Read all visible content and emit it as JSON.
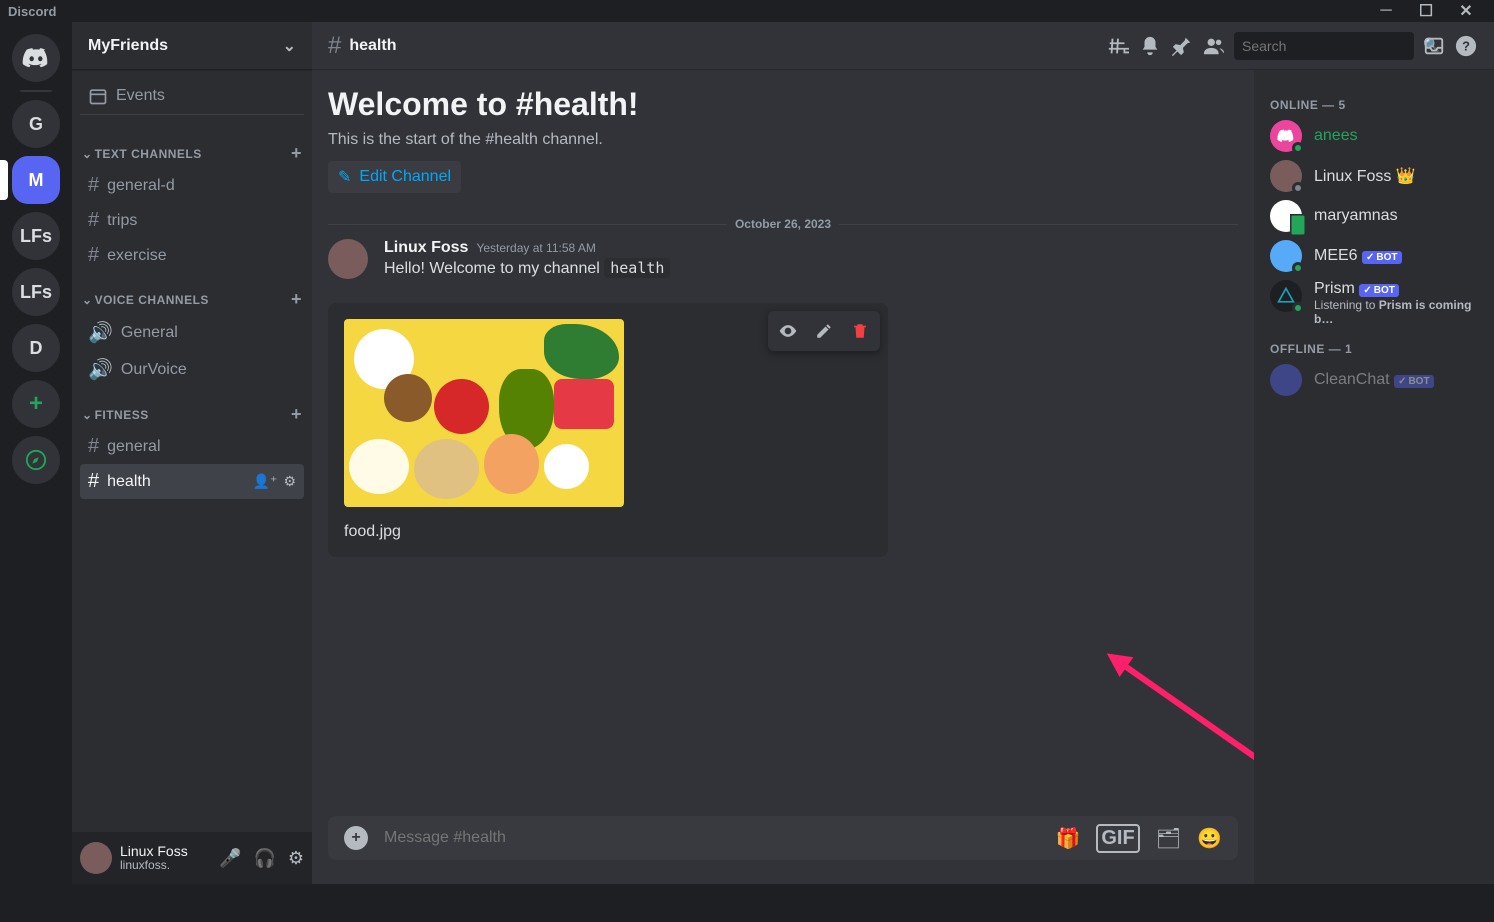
{
  "app_name": "Discord",
  "guilds": [
    {
      "id": "home",
      "letter": ""
    },
    {
      "id": "g",
      "letter": "G"
    },
    {
      "id": "m",
      "letter": "M",
      "selected": true
    },
    {
      "id": "lfs1",
      "letter": "LFs"
    },
    {
      "id": "lfs2",
      "letter": "LFs"
    },
    {
      "id": "d",
      "letter": "D"
    }
  ],
  "server": {
    "name": "MyFriends",
    "events_label": "Events",
    "categories": [
      {
        "label": "TEXT CHANNELS",
        "channels": [
          {
            "name": "general-d",
            "type": "text"
          },
          {
            "name": "trips",
            "type": "text"
          },
          {
            "name": "exercise",
            "type": "text"
          }
        ]
      },
      {
        "label": "VOICE CHANNELS",
        "channels": [
          {
            "name": "General",
            "type": "voice"
          },
          {
            "name": "OurVoice",
            "type": "voice"
          }
        ]
      },
      {
        "label": "FITNESS",
        "channels": [
          {
            "name": "general",
            "type": "text"
          },
          {
            "name": "health",
            "type": "text",
            "selected": true
          }
        ]
      }
    ]
  },
  "user_footer": {
    "display_name": "Linux Foss",
    "username": "linuxfoss."
  },
  "chat": {
    "channel_name": "health",
    "welcome_heading": "Welcome to #health!",
    "welcome_sub": "This is the start of the #health channel.",
    "edit_channel_label": "Edit Channel",
    "date_divider": "October 26, 2023",
    "message": {
      "author": "Linux Foss",
      "timestamp": "Yesterday at 11:58 AM",
      "text_prefix": "Hello! Welcome to my channel ",
      "text_code": "health"
    },
    "upload": {
      "filename": "food.jpg"
    },
    "composer_placeholder": "Message #health",
    "search_placeholder": "Search"
  },
  "members": {
    "online_label": "ONLINE — 5",
    "offline_label": "OFFLINE — 1",
    "online": [
      {
        "name": "anees",
        "color": "#23a55a",
        "avatar_bg": "#eb459e",
        "status": "#23a55a"
      },
      {
        "name": "Linux Foss",
        "color": "#f2f3f5",
        "crown": true,
        "avatar_bg": "#7a5c5c",
        "status": "#80848e"
      },
      {
        "name": "maryamnas",
        "color": "#f2f3f5",
        "avatar_bg": "#ffffff",
        "status": "#23a55a",
        "mobile": true
      },
      {
        "name": "MEE6",
        "color": "#f2f3f5",
        "bot": true,
        "avatar_bg": "#56aaf7",
        "status": "#23a55a"
      },
      {
        "name": "Prism",
        "color": "#f2f3f5",
        "bot": true,
        "avatar_bg": "#1e1f22",
        "status": "#23a55a",
        "activity_prefix": "Listening to ",
        "activity_bold": "Prism is coming b…"
      }
    ],
    "offline": [
      {
        "name": "CleanChat",
        "bot": true,
        "avatar_bg": "#5865f2",
        "dim": true
      }
    ]
  },
  "icons": {
    "help": "?",
    "bot_check": "✓",
    "bot_label": "BOT"
  }
}
